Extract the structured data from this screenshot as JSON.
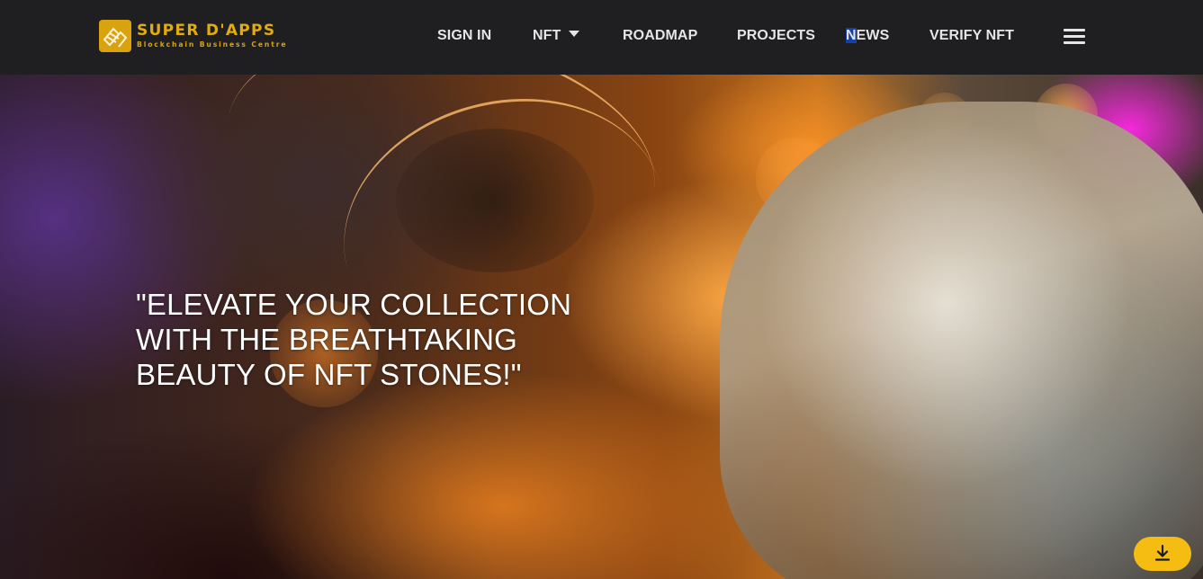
{
  "brand": {
    "title": "SUPER D'APPS",
    "subtitle": "Blockchain Business Centre",
    "logo_icon": "super-dapps-logo-icon",
    "accent_color": "#e2ab12"
  },
  "nav": {
    "sign_in": "SIGN IN",
    "nft": "NFT",
    "roadmap": "ROADMAP",
    "projects": "PROJECTS",
    "news_first": "N",
    "news_rest": "EWS",
    "verify_nft": "VERIFY NFT",
    "menu_icon": "hamburger-menu-icon",
    "nft_icon": "caret-down-icon"
  },
  "hero": {
    "quote_line1": "\"ELEVATE YOUR COLLECTION",
    "quote_line2": "WITH THE BREATHTAKING",
    "quote_line3": "BEAUTY OF NFT STONES!\""
  },
  "floating": {
    "download_icon": "download-icon",
    "button_color": "#f5bd12"
  }
}
